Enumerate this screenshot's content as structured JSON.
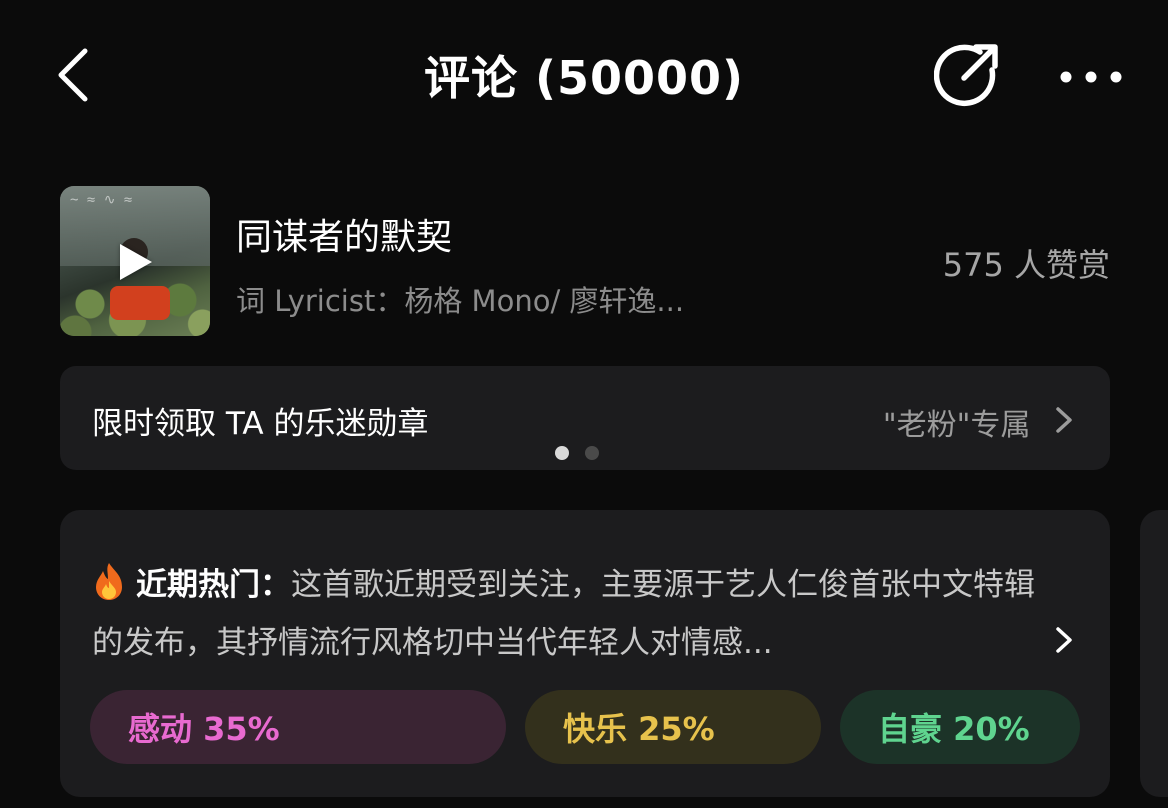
{
  "header": {
    "title": "评论 (50000)"
  },
  "song": {
    "title": "同谋者的默契",
    "subtitle": "词 Lyricist：杨格 Mono/ 廖轩逸...",
    "likes": "575 人赞赏"
  },
  "badge": {
    "text": "限时领取 TA 的乐迷勋章",
    "right_label": "\"老粉\"专属",
    "pages": 2,
    "active_page": 1
  },
  "hot": {
    "label": "近期热门：",
    "text": "这首歌近期受到关注，主要源于艺人仁俊首张中文特辑的发布，其抒情流行风格切中当代年轻人对情感..."
  },
  "tags": [
    {
      "label": "感动 35%",
      "color": "#e86ad0"
    },
    {
      "label": "快乐 25%",
      "color": "#e7c24c"
    },
    {
      "label": "自豪 20%",
      "color": "#5fd48f"
    }
  ],
  "icons": {
    "back": "chevron-left-icon",
    "share": "share-icon",
    "more": "more-dots-icon",
    "play": "play-icon",
    "fire": "fire-icon",
    "chevron": "chevron-right-icon"
  },
  "colors": {
    "background": "#0b0b0b",
    "card": "#1c1c1e",
    "secondary_text": "#8c8c8c"
  }
}
